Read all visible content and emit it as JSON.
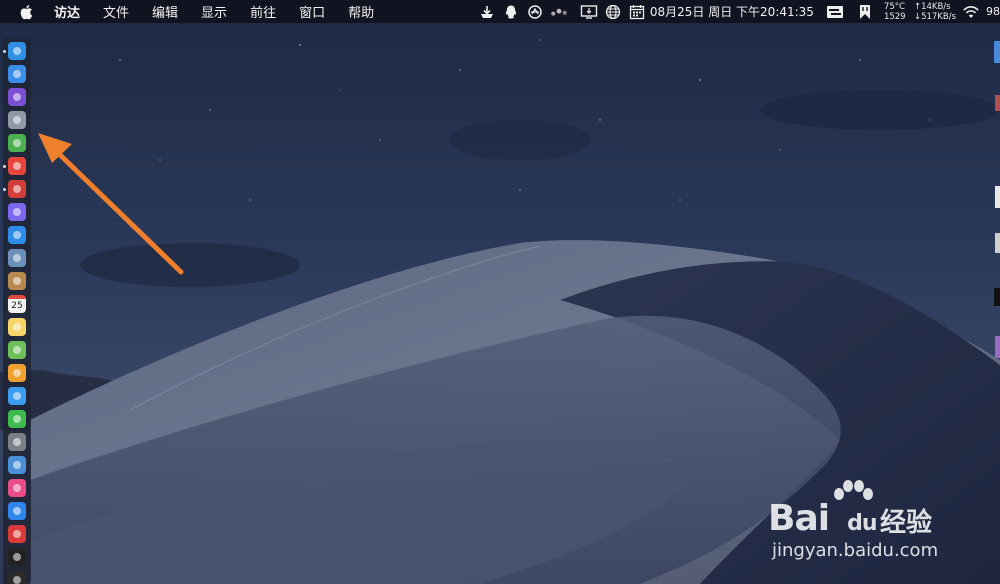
{
  "menubar": {
    "app_name": "访达",
    "menus": [
      "文件",
      "编辑",
      "显示",
      "前往",
      "窗口",
      "帮助"
    ],
    "clock": "08月25日 周日 下午20:41:35",
    "stats": {
      "temp": "75°C",
      "fan": "1529",
      "upload": "↑14KB/s",
      "download": "↓517KB/s"
    },
    "battery": "98"
  },
  "dock": {
    "items": [
      {
        "icon": "finder-icon",
        "color": "#2f8ee6",
        "running": true
      },
      {
        "icon": "app-store-icon",
        "color": "#3a8de8",
        "running": false
      },
      {
        "icon": "siri-icon",
        "color": "#7a4fd4",
        "running": false
      },
      {
        "icon": "launchpad-icon",
        "color": "#8f99a8",
        "running": false
      },
      {
        "icon": "android-studio-icon",
        "color": "#4caf50",
        "running": false
      },
      {
        "icon": "chrome-icon",
        "color": "#e8453c",
        "running": true
      },
      {
        "icon": "tower-icon",
        "color": "#d23f3a",
        "running": true
      },
      {
        "icon": "calculator-icon",
        "color": "#7b68ee",
        "running": false
      },
      {
        "icon": "safari-icon",
        "color": "#2d8bea",
        "running": false
      },
      {
        "icon": "preview-icon",
        "color": "#6a8fb8",
        "running": false
      },
      {
        "icon": "contacts-icon",
        "color": "#b8894e",
        "running": false
      },
      {
        "icon": "calendar-icon",
        "color": "#f2f2f2",
        "running": false,
        "label": "25"
      },
      {
        "icon": "notes-icon",
        "color": "#f6d66a",
        "running": false
      },
      {
        "icon": "maps-icon",
        "color": "#6cbf5a",
        "running": false
      },
      {
        "icon": "photos-icon",
        "color": "#f0a030",
        "running": false
      },
      {
        "icon": "messages-icon",
        "color": "#3b9cf0",
        "running": false
      },
      {
        "icon": "facetime-icon",
        "color": "#3dbb4c",
        "running": false
      },
      {
        "icon": "system-preferences-icon",
        "color": "#7c7f86",
        "running": false
      },
      {
        "icon": "keynote-icon",
        "color": "#4a90d9",
        "running": false
      },
      {
        "icon": "itunes-icon",
        "color": "#e84d8a",
        "running": false
      },
      {
        "icon": "app-store-icon-2",
        "color": "#2f86ea",
        "running": false
      },
      {
        "icon": "vivaldi-icon",
        "color": "#d93a3a",
        "running": false
      },
      {
        "icon": "terminal-icon",
        "color": "#222222",
        "running": false
      },
      {
        "icon": "activity-monitor-icon",
        "color": "#2b2b2b",
        "running": false
      }
    ]
  },
  "annotation": {
    "color": "#f07f2b"
  },
  "watermark": {
    "brand": "Bai",
    "brand2": "du",
    "cn": "经验",
    "url": "jingyan.baidu.com"
  }
}
